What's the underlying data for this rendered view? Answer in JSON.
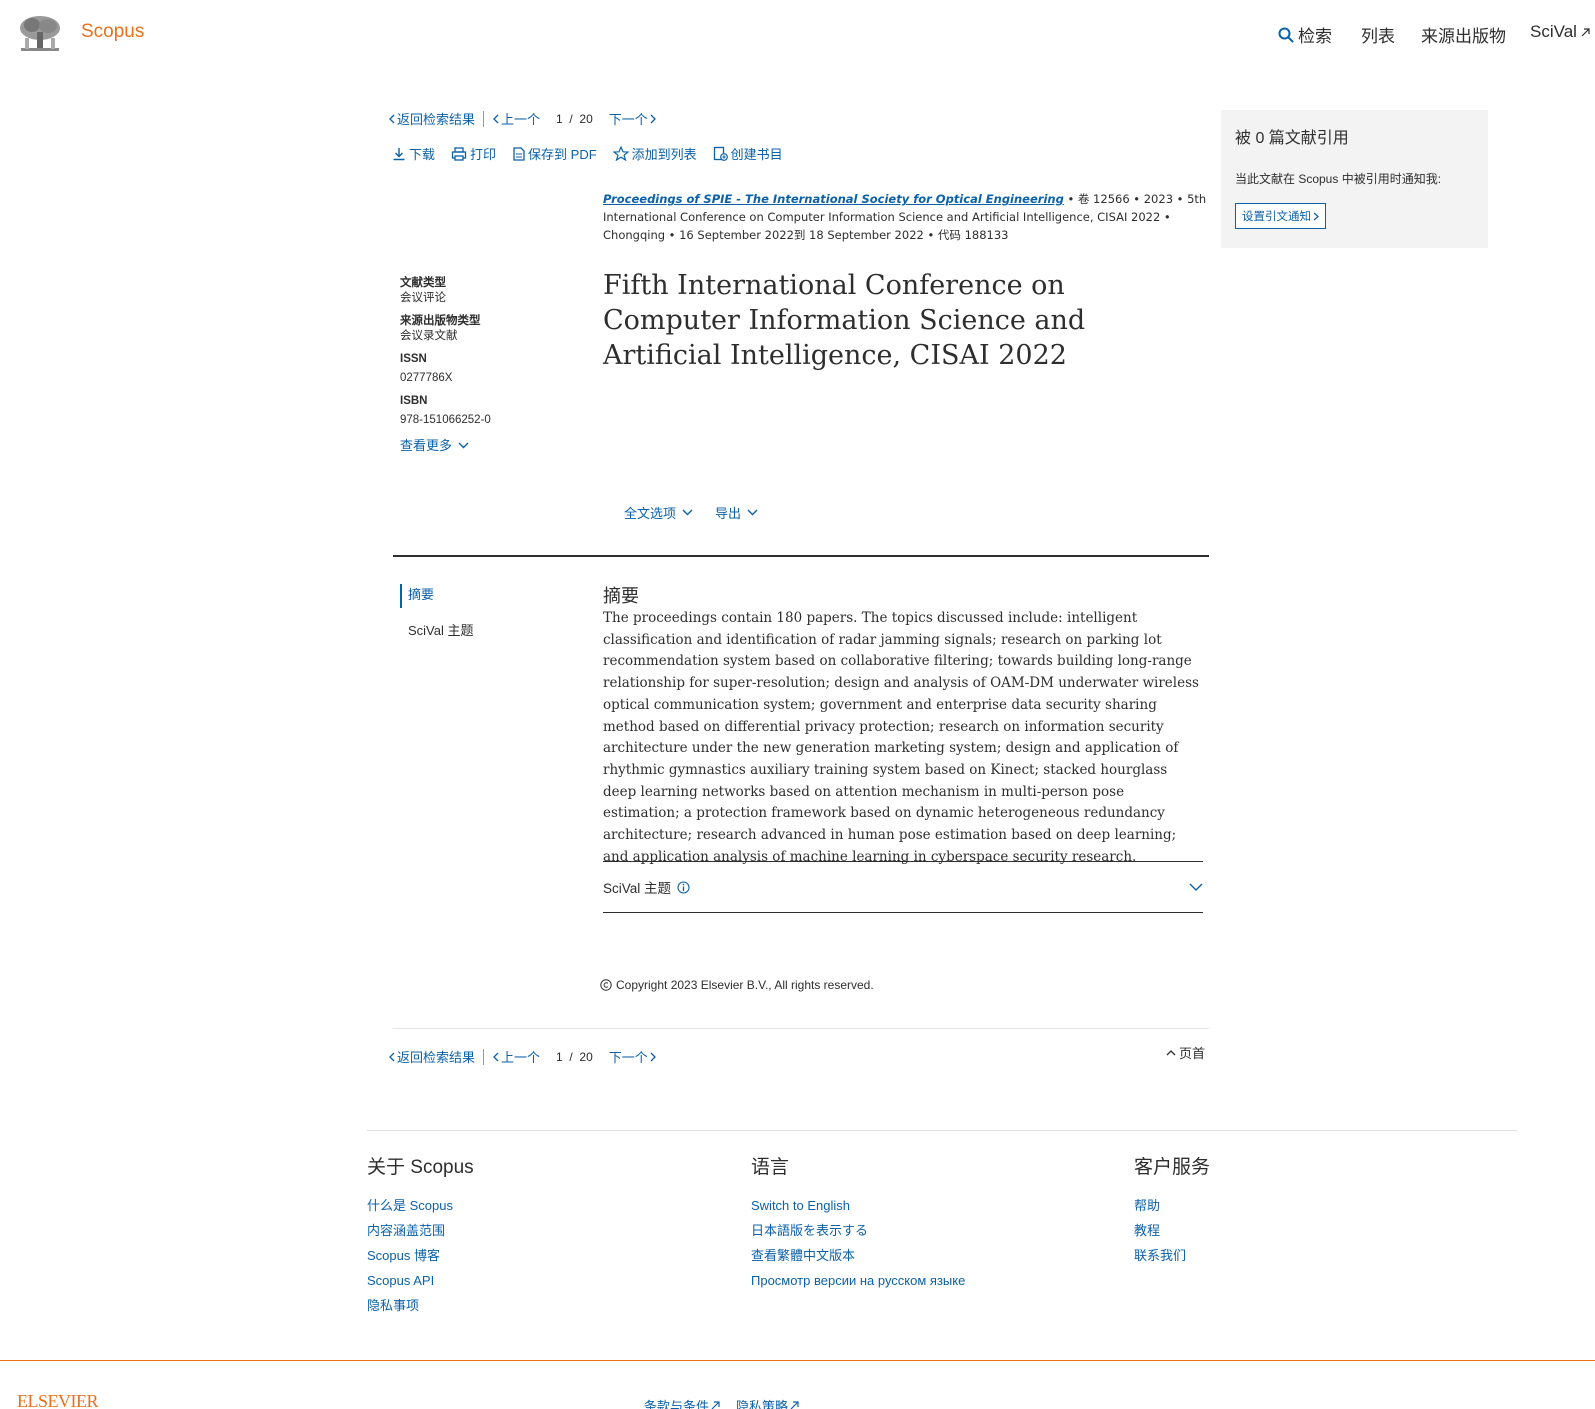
{
  "header": {
    "brand": "Scopus",
    "nav": [
      {
        "label": "检索",
        "icon": "search-icon"
      },
      {
        "label": "列表"
      },
      {
        "label": "来源出版物"
      },
      {
        "label": "SciVal",
        "icon": "external-link-icon"
      }
    ]
  },
  "pager": {
    "back": "返回检索结果",
    "prev": "上一个",
    "current": "1",
    "slash": "/",
    "total": "20",
    "next": "下一个"
  },
  "toolbar": {
    "download": "下载",
    "print": "打印",
    "save_pdf": "保存到 PDF",
    "add_list": "添加到列表",
    "bibliography": "创建书目"
  },
  "source": {
    "journal": "Proceedings of SPIE - The International Society for Optical Engineering",
    "rest": " • 卷 12566 • 2023 • 5th International Conference on Computer Information Science and Artificial Intelligence, CISAI 2022 • Chongqing • 16 September 2022到 18 September 2022 • 代码 188133"
  },
  "title": "Fifth International Conference on Computer Information Science and Artificial Intelligence, CISAI 2022",
  "meta": {
    "doc_type_label": "文献类型",
    "doc_type": "会议评论",
    "source_type_label": "来源出版物类型",
    "source_type": "会议录文献",
    "issn_label": "ISSN",
    "issn": "0277786X",
    "isbn_label": "ISBN",
    "isbn": "978-151066252-0",
    "more": "查看更多"
  },
  "options": {
    "fulltext": "全文选项",
    "export": "导出"
  },
  "sidenav": {
    "abstract": "摘要",
    "scival": "SciVal 主题"
  },
  "abstract": {
    "heading": "摘要",
    "text": "The proceedings contain 180 papers. The topics discussed include: intelligent classification and identification of radar jamming signals; research on parking lot recommendation system based on collaborative filtering; towards building long-range relationship for super-resolution; design and analysis of OAM-DM underwater wireless optical communication system; government and enterprise data security sharing method based on differential privacy protection; research on information security architecture under the new generation marketing system; design and application of rhythmic gymnastics auxiliary training system based on Kinect; stacked hourglass deep learning networks based on attention mechanism in multi-person pose estimation; a protection framework based on dynamic heterogeneous redundancy architecture; research advanced in human pose estimation based on deep learning; and application analysis of machine learning in cyberspace security research."
  },
  "scival_section": "SciVal 主题",
  "copyright": "Copyright 2023 Elsevier B.V., All rights reserved.",
  "top_of_page": "页首",
  "panel": {
    "title": "被 0 篇文献引用",
    "text": "当此文献在 Scopus 中被引用时通知我:",
    "button": "设置引文通知"
  },
  "footer": {
    "about": {
      "heading": "关于 Scopus",
      "links": [
        "什么是 Scopus",
        "内容涵盖范围",
        "Scopus 博客",
        "Scopus API",
        "隐私事项"
      ]
    },
    "language": {
      "heading": "语言",
      "links": [
        "Switch to English",
        "日本語版を表示する",
        "查看繁體中文版本",
        "Просмотр версии на русском языке"
      ]
    },
    "service": {
      "heading": "客户服务",
      "links": [
        "帮助",
        "教程",
        "联系我们"
      ]
    },
    "brand": "ELSEVIER",
    "terms": "条款与条件",
    "privacy": "隐私策略"
  }
}
